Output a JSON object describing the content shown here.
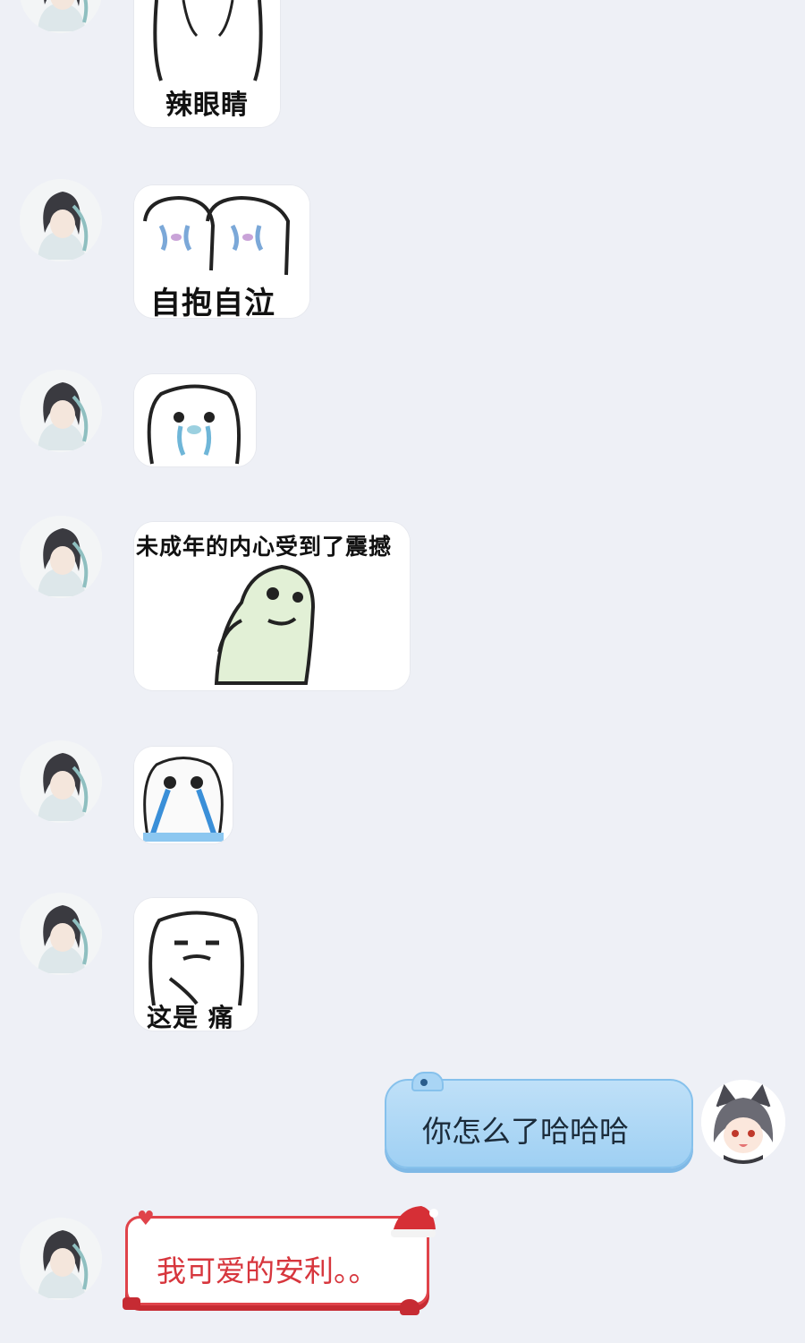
{
  "messages": [
    {
      "side": "left",
      "type": "sticker",
      "caption": "辣眼睛"
    },
    {
      "side": "left",
      "type": "sticker",
      "caption": "自抱自泣"
    },
    {
      "side": "left",
      "type": "sticker",
      "caption": ""
    },
    {
      "side": "left",
      "type": "sticker",
      "caption": "未成年的内心受到了震撼"
    },
    {
      "side": "left",
      "type": "sticker",
      "caption": ""
    },
    {
      "side": "left",
      "type": "sticker",
      "caption": "这是 痛"
    },
    {
      "side": "right",
      "type": "text",
      "text": "你怎么了哈哈哈"
    },
    {
      "side": "left",
      "type": "text",
      "text": "我可爱的安利。。"
    }
  ],
  "colors": {
    "background": "#eef0f6",
    "outgoing_bubble": "#a9d5f5",
    "incoming_bubble_border": "#e0434a",
    "incoming_text": "#d7363d"
  },
  "icons": {
    "friend_avatar": "anime-boy-avatar",
    "self_avatar": "cat-girl-avatar"
  }
}
